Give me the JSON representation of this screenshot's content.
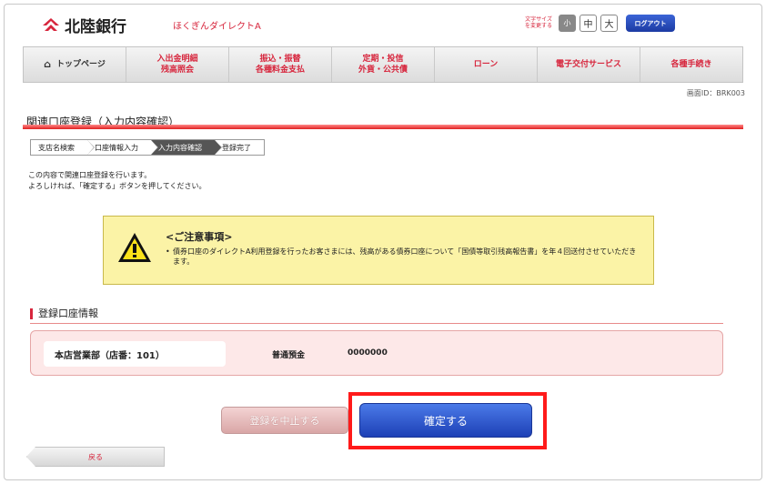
{
  "header": {
    "logo_text": "北陸銀行",
    "service_name": "ほくぎんダイレクトA",
    "font_size_label": "文字サイズを変更する",
    "font_small": "小",
    "font_medium": "中",
    "font_large": "大",
    "logout_label": "ログアウト"
  },
  "nav": {
    "items": [
      {
        "label": "トップページ",
        "icon": "home-icon"
      },
      {
        "label": "入出金明細\n残高照会"
      },
      {
        "label": "振込・振替\n各種料金支払"
      },
      {
        "label": "定期・投信\n外貨・公共債"
      },
      {
        "label": "ローン"
      },
      {
        "label": "電子交付サービス"
      },
      {
        "label": "各種手続き"
      }
    ]
  },
  "screen_id": "画面ID：BRK003",
  "page_title": "関連口座登録（入力内容確認）",
  "steps": [
    {
      "label": "支店名検索",
      "active": false
    },
    {
      "label": "口座情報入力",
      "active": false
    },
    {
      "label": "入力内容確認",
      "active": true
    },
    {
      "label": "登録完了",
      "active": false
    }
  ],
  "description": {
    "line1": "この内容で関連口座登録を行います。",
    "line2": "よろしければ、「確定する」ボタンを押してください。"
  },
  "notice": {
    "title": "<ご注意事項>",
    "body": "債券口座のダイレクトA利用登録を行ったお客さまには、残高がある債券口座について「国債等取引残高報告書」を年４回送付させていただきます。",
    "icon": "warning-icon"
  },
  "section": {
    "title": "登録口座情報",
    "branch": "本店営業部（店番：101）",
    "account_type": "普通預金",
    "account_number": "0000000"
  },
  "buttons": {
    "cancel": "登録を中止する",
    "confirm": "確定する",
    "back": "戻る"
  },
  "colors": {
    "brand_red": "#d7263d",
    "confirm_blue": "#1d40b6",
    "highlight_red": "#ff1a1a",
    "notice_yellow": "#fbf3a6"
  }
}
